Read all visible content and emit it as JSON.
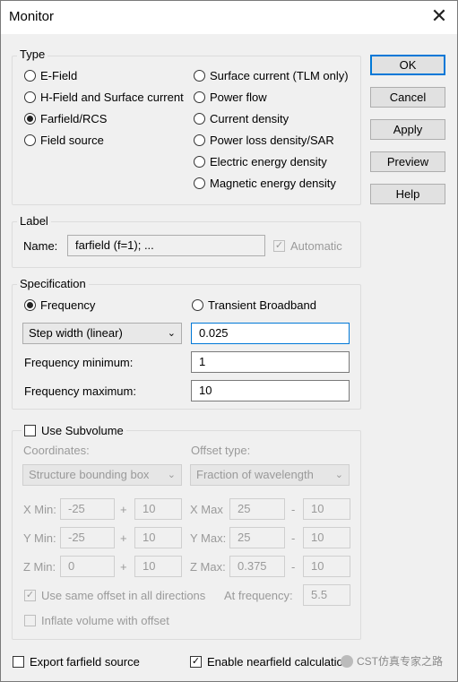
{
  "window": {
    "title": "Monitor",
    "close_symbol": "✕"
  },
  "type_group": {
    "label": "Type",
    "options_left": [
      "E-Field",
      "H-Field and Surface current",
      "Farfield/RCS",
      "Field source"
    ],
    "options_right": [
      "Surface current (TLM only)",
      "Power flow",
      "Current density",
      "Power loss density/SAR",
      "Electric energy density",
      "Magnetic energy density"
    ],
    "selected": "Farfield/RCS"
  },
  "buttons": {
    "ok": "OK",
    "cancel": "Cancel",
    "apply": "Apply",
    "preview": "Preview",
    "help": "Help"
  },
  "label_group": {
    "label": "Label",
    "name_label": "Name:",
    "name_value": "farfield (f=1); ...",
    "automatic_label": "Automatic",
    "automatic_checked": true
  },
  "specification": {
    "label": "Specification",
    "frequency_label": "Frequency",
    "transient_label": "Transient Broadband",
    "selected": "Frequency",
    "step_mode": "Step width (linear)",
    "step_value": "0.025",
    "freq_min_label": "Frequency minimum:",
    "freq_min_value": "1",
    "freq_max_label": "Frequency maximum:",
    "freq_max_value": "10"
  },
  "subvolume": {
    "checkbox_label": "Use Subvolume",
    "checked": false,
    "coordinates_label": "Coordinates:",
    "coordinates_value": "Structure bounding box",
    "offset_type_label": "Offset type:",
    "offset_type_value": "Fraction of wavelength",
    "plus": "+",
    "minus": "-",
    "rows": [
      {
        "min_label": "X Min:",
        "min_value": "-25",
        "min_offset": "10",
        "max_label": "X Max",
        "max_value": "25",
        "max_offset": "10"
      },
      {
        "min_label": "Y Min:",
        "min_value": "-25",
        "min_offset": "10",
        "max_label": "Y Max:",
        "max_value": "25",
        "max_offset": "10"
      },
      {
        "min_label": "Z Min:",
        "min_value": "0",
        "min_offset": "10",
        "max_label": "Z Max:",
        "max_value": "0.375",
        "max_offset": "10"
      }
    ],
    "same_offset_label": "Use same offset in all directions",
    "same_offset_checked": true,
    "at_frequency_label": "At frequency:",
    "at_frequency_value": "5.5",
    "inflate_label": "Inflate volume with offset",
    "inflate_checked": false
  },
  "bottom": {
    "export_label": "Export farfield source",
    "export_checked": false,
    "nearfield_label": "Enable nearfield calculation",
    "nearfield_checked": true
  },
  "watermark": "CST仿真专家之路"
}
